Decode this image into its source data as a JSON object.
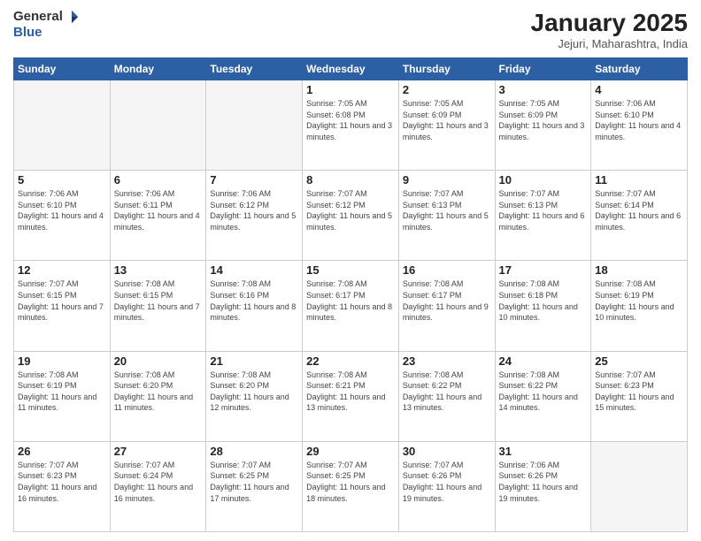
{
  "header": {
    "logo": {
      "general": "General",
      "blue": "Blue"
    },
    "title": "January 2025",
    "location": "Jejuri, Maharashtra, India"
  },
  "weekdays": [
    "Sunday",
    "Monday",
    "Tuesday",
    "Wednesday",
    "Thursday",
    "Friday",
    "Saturday"
  ],
  "weeks": [
    [
      {
        "day": "",
        "empty": true
      },
      {
        "day": "",
        "empty": true
      },
      {
        "day": "",
        "empty": true
      },
      {
        "day": "1",
        "sunrise": "Sunrise: 7:05 AM",
        "sunset": "Sunset: 6:08 PM",
        "daylight": "Daylight: 11 hours and 3 minutes."
      },
      {
        "day": "2",
        "sunrise": "Sunrise: 7:05 AM",
        "sunset": "Sunset: 6:09 PM",
        "daylight": "Daylight: 11 hours and 3 minutes."
      },
      {
        "day": "3",
        "sunrise": "Sunrise: 7:05 AM",
        "sunset": "Sunset: 6:09 PM",
        "daylight": "Daylight: 11 hours and 3 minutes."
      },
      {
        "day": "4",
        "sunrise": "Sunrise: 7:06 AM",
        "sunset": "Sunset: 6:10 PM",
        "daylight": "Daylight: 11 hours and 4 minutes."
      }
    ],
    [
      {
        "day": "5",
        "sunrise": "Sunrise: 7:06 AM",
        "sunset": "Sunset: 6:10 PM",
        "daylight": "Daylight: 11 hours and 4 minutes."
      },
      {
        "day": "6",
        "sunrise": "Sunrise: 7:06 AM",
        "sunset": "Sunset: 6:11 PM",
        "daylight": "Daylight: 11 hours and 4 minutes."
      },
      {
        "day": "7",
        "sunrise": "Sunrise: 7:06 AM",
        "sunset": "Sunset: 6:12 PM",
        "daylight": "Daylight: 11 hours and 5 minutes."
      },
      {
        "day": "8",
        "sunrise": "Sunrise: 7:07 AM",
        "sunset": "Sunset: 6:12 PM",
        "daylight": "Daylight: 11 hours and 5 minutes."
      },
      {
        "day": "9",
        "sunrise": "Sunrise: 7:07 AM",
        "sunset": "Sunset: 6:13 PM",
        "daylight": "Daylight: 11 hours and 5 minutes."
      },
      {
        "day": "10",
        "sunrise": "Sunrise: 7:07 AM",
        "sunset": "Sunset: 6:13 PM",
        "daylight": "Daylight: 11 hours and 6 minutes."
      },
      {
        "day": "11",
        "sunrise": "Sunrise: 7:07 AM",
        "sunset": "Sunset: 6:14 PM",
        "daylight": "Daylight: 11 hours and 6 minutes."
      }
    ],
    [
      {
        "day": "12",
        "sunrise": "Sunrise: 7:07 AM",
        "sunset": "Sunset: 6:15 PM",
        "daylight": "Daylight: 11 hours and 7 minutes."
      },
      {
        "day": "13",
        "sunrise": "Sunrise: 7:08 AM",
        "sunset": "Sunset: 6:15 PM",
        "daylight": "Daylight: 11 hours and 7 minutes."
      },
      {
        "day": "14",
        "sunrise": "Sunrise: 7:08 AM",
        "sunset": "Sunset: 6:16 PM",
        "daylight": "Daylight: 11 hours and 8 minutes."
      },
      {
        "day": "15",
        "sunrise": "Sunrise: 7:08 AM",
        "sunset": "Sunset: 6:17 PM",
        "daylight": "Daylight: 11 hours and 8 minutes."
      },
      {
        "day": "16",
        "sunrise": "Sunrise: 7:08 AM",
        "sunset": "Sunset: 6:17 PM",
        "daylight": "Daylight: 11 hours and 9 minutes."
      },
      {
        "day": "17",
        "sunrise": "Sunrise: 7:08 AM",
        "sunset": "Sunset: 6:18 PM",
        "daylight": "Daylight: 11 hours and 10 minutes."
      },
      {
        "day": "18",
        "sunrise": "Sunrise: 7:08 AM",
        "sunset": "Sunset: 6:19 PM",
        "daylight": "Daylight: 11 hours and 10 minutes."
      }
    ],
    [
      {
        "day": "19",
        "sunrise": "Sunrise: 7:08 AM",
        "sunset": "Sunset: 6:19 PM",
        "daylight": "Daylight: 11 hours and 11 minutes."
      },
      {
        "day": "20",
        "sunrise": "Sunrise: 7:08 AM",
        "sunset": "Sunset: 6:20 PM",
        "daylight": "Daylight: 11 hours and 11 minutes."
      },
      {
        "day": "21",
        "sunrise": "Sunrise: 7:08 AM",
        "sunset": "Sunset: 6:20 PM",
        "daylight": "Daylight: 11 hours and 12 minutes."
      },
      {
        "day": "22",
        "sunrise": "Sunrise: 7:08 AM",
        "sunset": "Sunset: 6:21 PM",
        "daylight": "Daylight: 11 hours and 13 minutes."
      },
      {
        "day": "23",
        "sunrise": "Sunrise: 7:08 AM",
        "sunset": "Sunset: 6:22 PM",
        "daylight": "Daylight: 11 hours and 13 minutes."
      },
      {
        "day": "24",
        "sunrise": "Sunrise: 7:08 AM",
        "sunset": "Sunset: 6:22 PM",
        "daylight": "Daylight: 11 hours and 14 minutes."
      },
      {
        "day": "25",
        "sunrise": "Sunrise: 7:07 AM",
        "sunset": "Sunset: 6:23 PM",
        "daylight": "Daylight: 11 hours and 15 minutes."
      }
    ],
    [
      {
        "day": "26",
        "sunrise": "Sunrise: 7:07 AM",
        "sunset": "Sunset: 6:23 PM",
        "daylight": "Daylight: 11 hours and 16 minutes."
      },
      {
        "day": "27",
        "sunrise": "Sunrise: 7:07 AM",
        "sunset": "Sunset: 6:24 PM",
        "daylight": "Daylight: 11 hours and 16 minutes."
      },
      {
        "day": "28",
        "sunrise": "Sunrise: 7:07 AM",
        "sunset": "Sunset: 6:25 PM",
        "daylight": "Daylight: 11 hours and 17 minutes."
      },
      {
        "day": "29",
        "sunrise": "Sunrise: 7:07 AM",
        "sunset": "Sunset: 6:25 PM",
        "daylight": "Daylight: 11 hours and 18 minutes."
      },
      {
        "day": "30",
        "sunrise": "Sunrise: 7:07 AM",
        "sunset": "Sunset: 6:26 PM",
        "daylight": "Daylight: 11 hours and 19 minutes."
      },
      {
        "day": "31",
        "sunrise": "Sunrise: 7:06 AM",
        "sunset": "Sunset: 6:26 PM",
        "daylight": "Daylight: 11 hours and 19 minutes."
      },
      {
        "day": "",
        "empty": true
      }
    ]
  ]
}
